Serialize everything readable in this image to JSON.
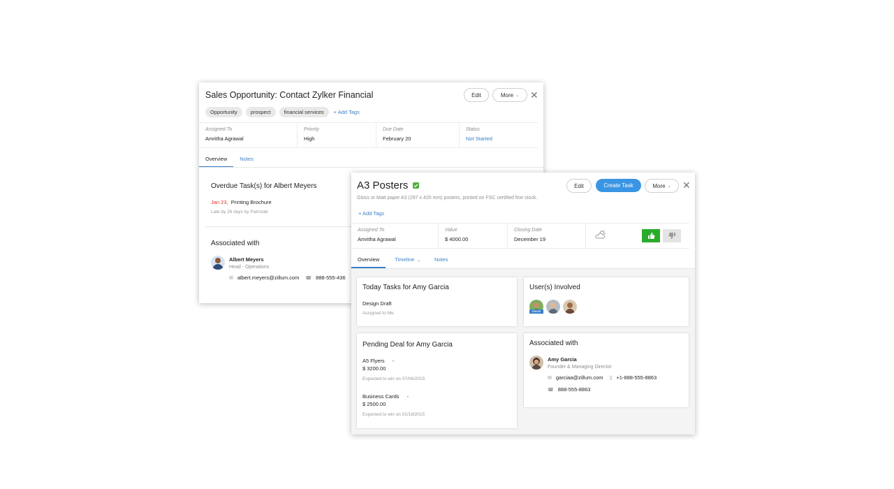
{
  "back": {
    "title": "Sales Opportunity: Contact Zylker Financial",
    "edit_label": "Edit",
    "more_label": "More",
    "tags": [
      "Opportunity",
      "prospect",
      "financial services"
    ],
    "add_tags_label": "+ Add Tags",
    "fields": [
      {
        "label": "Assigned To",
        "value": "Amritha Agrawal"
      },
      {
        "label": "Priority",
        "value": "High"
      },
      {
        "label": "Due Date",
        "value": "February 20"
      },
      {
        "label": "Status",
        "value": "Not Started"
      }
    ],
    "tabs": [
      "Overview",
      "Notes"
    ],
    "overdue": {
      "title": "Overdue Task(s) for Albert Meyers",
      "date": "Jan 23,",
      "task": "Printing Brochure",
      "note": "Late by 26 days by Patriciab"
    },
    "associated": {
      "title": "Associated with",
      "name": "Albert Meyers",
      "role": "Head - Operations",
      "email": "albert.meyers@zillum.com",
      "phone": "888-555-436"
    }
  },
  "front": {
    "title": "A3 Posters",
    "edit_label": "Edit",
    "create_task_label": "Create Task",
    "more_label": "More",
    "description": "Gloss or Matt paper A3 (297 x 420 mm) posters, printed on FSC certified fine stock.",
    "add_tags_label": "+ Add Tags",
    "fields": [
      {
        "label": "Assigned To",
        "value": "Amritha Agrawal"
      },
      {
        "label": "Value",
        "value": "$ 4000.00"
      },
      {
        "label": "Closing Date",
        "value": "December 19"
      }
    ],
    "tabs": {
      "overview": "Overview",
      "timeline": "Timeline",
      "notes": "Notes"
    },
    "today": {
      "title": "Today Tasks for Amy Garcia",
      "task": "Design Draft",
      "assigned": "Assigned to Me"
    },
    "pending": {
      "title": "Pending Deal for Amy Garcia",
      "deals": [
        {
          "name": "A5 Flyers",
          "dash": "-",
          "amount": "$ 3200.00",
          "note": "Expected to win on 07/06/2015"
        },
        {
          "name": "Business Cards",
          "dash": "-",
          "amount": "$ 2500.00",
          "note": "Expected to win on 02/18/2015"
        }
      ]
    },
    "users": {
      "title": "User(s) Involved",
      "owner_badge": "Owner"
    },
    "associated": {
      "title": "Associated with",
      "name": "Amy Garcia",
      "role": "Founder & Managing Director",
      "email": "garciaa@zillum.com",
      "mobile": "+1-888-555-8863",
      "phone": "888-555-8863"
    }
  },
  "colors": {
    "accent": "#3a80c9",
    "primary": "#3a95e3",
    "success": "#2bab2b",
    "overdue": "#e0312d"
  }
}
